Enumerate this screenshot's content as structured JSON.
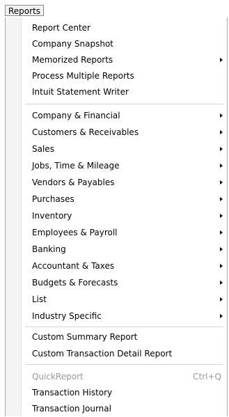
{
  "menubar": {
    "reports_label": "Reports"
  },
  "menu": {
    "group1": [
      {
        "label": "Report Center"
      },
      {
        "label": "Company Snapshot"
      },
      {
        "label": "Memorized Reports",
        "submenu": true
      },
      {
        "label": "Process Multiple Reports"
      },
      {
        "label": "Intuit Statement Writer"
      }
    ],
    "group2": [
      {
        "label": "Company & Financial",
        "submenu": true
      },
      {
        "label": "Customers & Receivables",
        "submenu": true
      },
      {
        "label": "Sales",
        "submenu": true
      },
      {
        "label": "Jobs, Time & Mileage",
        "submenu": true
      },
      {
        "label": "Vendors & Payables",
        "submenu": true
      },
      {
        "label": "Purchases",
        "submenu": true
      },
      {
        "label": "Inventory",
        "submenu": true
      },
      {
        "label": "Employees & Payroll",
        "submenu": true
      },
      {
        "label": "Banking",
        "submenu": true
      },
      {
        "label": "Accountant & Taxes",
        "submenu": true
      },
      {
        "label": "Budgets & Forecasts",
        "submenu": true
      },
      {
        "label": "List",
        "submenu": true
      },
      {
        "label": "Industry Specific",
        "submenu": true
      }
    ],
    "group3": [
      {
        "label": "Custom Summary Report"
      },
      {
        "label": "Custom Transaction Detail Report"
      }
    ],
    "group4": [
      {
        "label": "QuickReport",
        "shortcut": "Ctrl+Q",
        "disabled": true
      },
      {
        "label": "Transaction History"
      },
      {
        "label": "Transaction Journal"
      }
    ]
  }
}
